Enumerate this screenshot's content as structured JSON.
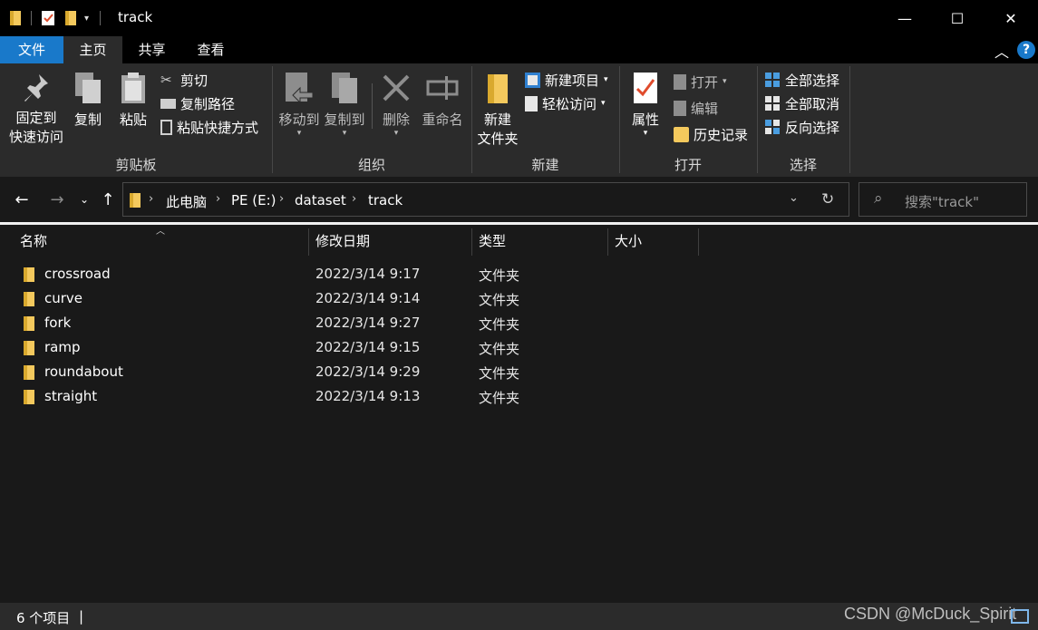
{
  "window": {
    "title": "track",
    "controls": {
      "minimize": "—",
      "maximize": "☐",
      "close": "✕"
    }
  },
  "tabs": [
    {
      "label": "文件"
    },
    {
      "label": "主页"
    },
    {
      "label": "共享"
    },
    {
      "label": "查看"
    }
  ],
  "ribbon": {
    "clipboard": {
      "group_label": "剪贴板",
      "pin_line1": "固定到",
      "pin_line2": "快速访问",
      "copy": "复制",
      "paste": "粘贴",
      "cut": "剪切",
      "copy_path": "复制路径",
      "paste_shortcut": "粘贴快捷方式"
    },
    "organize": {
      "group_label": "组织",
      "move_to": "移动到",
      "copy_to": "复制到",
      "delete": "删除",
      "rename": "重命名"
    },
    "new": {
      "group_label": "新建",
      "new_folder_line1": "新建",
      "new_folder_line2": "文件夹",
      "new_item": "新建项目",
      "easy_access": "轻松访问"
    },
    "open": {
      "group_label": "打开",
      "properties": "属性",
      "open": "打开",
      "edit": "编辑",
      "history": "历史记录"
    },
    "select": {
      "group_label": "选择",
      "select_all": "全部选择",
      "select_none": "全部取消",
      "invert": "反向选择"
    }
  },
  "address": {
    "crumbs": [
      "此电脑",
      "PE (E:)",
      "dataset",
      "track"
    ],
    "search_placeholder": "搜索\"track\""
  },
  "columns": [
    "名称",
    "修改日期",
    "类型",
    "大小"
  ],
  "files": [
    {
      "name": "crossroad",
      "date": "2022/3/14 9:17",
      "type": "文件夹"
    },
    {
      "name": "curve",
      "date": "2022/3/14 9:14",
      "type": "文件夹"
    },
    {
      "name": "fork",
      "date": "2022/3/14 9:27",
      "type": "文件夹"
    },
    {
      "name": "ramp",
      "date": "2022/3/14 9:15",
      "type": "文件夹"
    },
    {
      "name": "roundabout",
      "date": "2022/3/14 9:29",
      "type": "文件夹"
    },
    {
      "name": "straight",
      "date": "2022/3/14 9:13",
      "type": "文件夹"
    }
  ],
  "status": {
    "item_count": "6 个项目",
    "watermark": "CSDN @McDuck_Spirit"
  },
  "colors": {
    "accent": "#1979ca",
    "folder": "#f4c95d",
    "ribbon_bg": "#2b2b2b",
    "window_bg": "#191919"
  }
}
